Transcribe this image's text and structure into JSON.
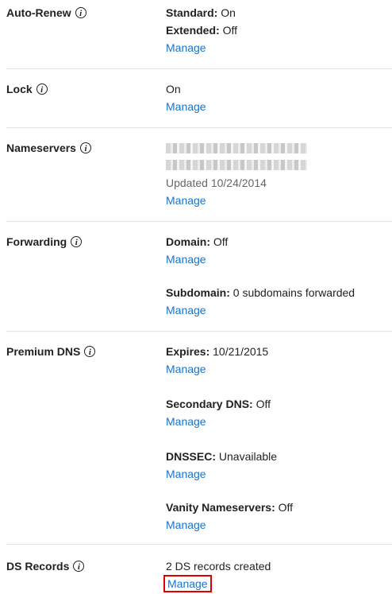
{
  "sections": {
    "auto_renew": {
      "label": "Auto-Renew",
      "standard_key": "Standard:",
      "standard_val": " On",
      "extended_key": "Extended:",
      "extended_val": " Off",
      "manage": "Manage"
    },
    "lock": {
      "label": "Lock",
      "value": "On",
      "manage": "Manage"
    },
    "nameservers": {
      "label": "Nameservers",
      "updated": "Updated 10/24/2014",
      "manage": "Manage"
    },
    "forwarding": {
      "label": "Forwarding",
      "domain_key": "Domain:",
      "domain_val": " Off",
      "domain_manage": "Manage",
      "subdomain_key": "Subdomain:",
      "subdomain_val": " 0 subdomains forwarded",
      "subdomain_manage": "Manage"
    },
    "premium_dns": {
      "label": "Premium DNS",
      "expires_key": "Expires:",
      "expires_val": " 10/21/2015",
      "expires_manage": "Manage",
      "secondary_key": "Secondary DNS:",
      "secondary_val": " Off",
      "secondary_manage": "Manage",
      "dnssec_key": "DNSSEC:",
      "dnssec_val": " Unavailable",
      "dnssec_manage": "Manage",
      "vanity_key": "Vanity Nameservers:",
      "vanity_val": " Off",
      "vanity_manage": "Manage"
    },
    "ds_records": {
      "label": "DS Records",
      "value": "2 DS records created",
      "manage": "Manage"
    }
  },
  "info_glyph": "i",
  "colors": {
    "link": "#1a73c8",
    "highlight": "#e00000",
    "divider": "#e2e2e2"
  }
}
